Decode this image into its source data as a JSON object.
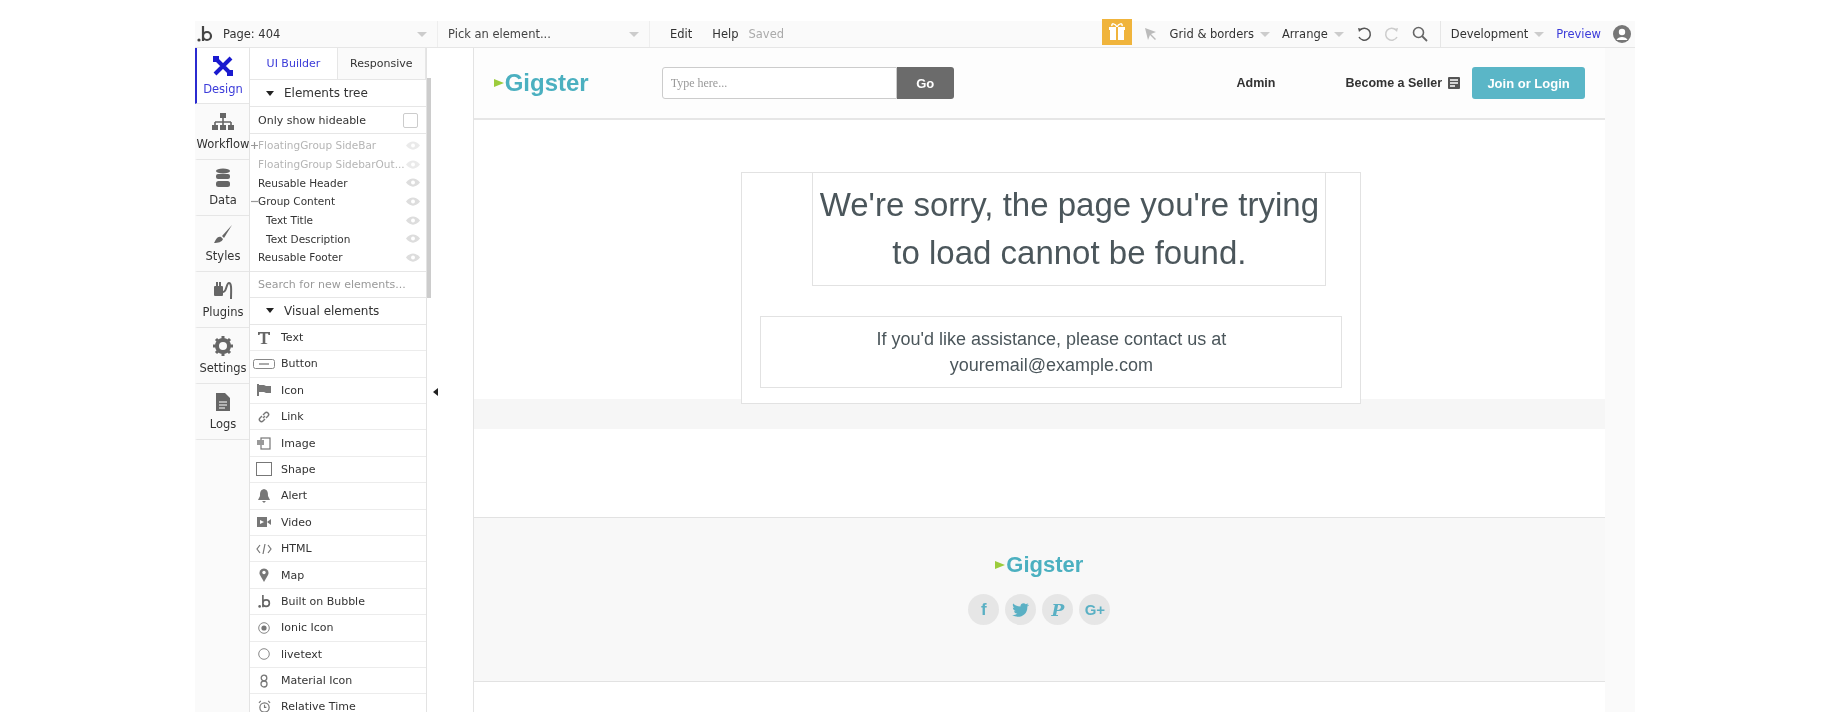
{
  "topbar": {
    "page": "Page: 404",
    "element_picker": {
      "placeholder": "Pick an element..."
    },
    "menu": [
      "Edit",
      "Help"
    ],
    "status": "Saved",
    "tools": [
      "Grid & borders",
      "Arrange"
    ],
    "environment": "Development",
    "preview": "Preview"
  },
  "sidebar": {
    "items": [
      {
        "label": "Design",
        "kind": "design",
        "selected": true
      },
      {
        "label": "Workflow",
        "kind": "workflow",
        "selected": false
      },
      {
        "label": "Data",
        "kind": "data",
        "selected": false
      },
      {
        "label": "Styles",
        "kind": "styles",
        "selected": false
      },
      {
        "label": "Plugins",
        "kind": "plugins",
        "selected": false
      },
      {
        "label": "Settings",
        "kind": "settings",
        "selected": false
      },
      {
        "label": "Logs",
        "kind": "logs",
        "selected": false
      }
    ]
  },
  "panel": {
    "tabs": [
      {
        "label": "UI Builder",
        "selected": true
      },
      {
        "label": "Responsive",
        "selected": false
      }
    ],
    "elements_tree": {
      "title": "Elements tree",
      "expanded": true,
      "only_show_hideable": {
        "label": "Only show hideable",
        "checked": false
      },
      "items": [
        {
          "label": "FloatingGroup SideBar",
          "kind": "group",
          "expanded": false,
          "hidden": true
        },
        {
          "label": "FloatingGroup SidebarOut...",
          "kind": "element",
          "hidden": true
        },
        {
          "label": "Reusable Header",
          "kind": "element",
          "hidden": false
        },
        {
          "label": "Group Content",
          "kind": "group",
          "expanded": true,
          "hidden": false,
          "children": [
            {
              "label": "Text Title",
              "hidden": false
            },
            {
              "label": "Text Description",
              "hidden": false
            }
          ]
        },
        {
          "label": "Reusable Footer",
          "kind": "element",
          "hidden": false
        }
      ]
    },
    "search": {
      "placeholder": "Search for new elements..."
    },
    "visual_elements": {
      "title": "Visual elements",
      "expanded": true,
      "items": [
        {
          "label": "Text",
          "kind": "text"
        },
        {
          "label": "Button",
          "kind": "button"
        },
        {
          "label": "Icon",
          "kind": "icon"
        },
        {
          "label": "Link",
          "kind": "link"
        },
        {
          "label": "Image",
          "kind": "image"
        },
        {
          "label": "Shape",
          "kind": "shape"
        },
        {
          "label": "Alert",
          "kind": "alert"
        },
        {
          "label": "Video",
          "kind": "video"
        },
        {
          "label": "HTML",
          "kind": "html"
        },
        {
          "label": "Map",
          "kind": "map"
        },
        {
          "label": "Built on Bubble",
          "kind": "bubble"
        },
        {
          "label": "Ionic Icon",
          "kind": "ionic"
        },
        {
          "label": "livetext",
          "kind": "livetext"
        },
        {
          "label": "Material Icon",
          "kind": "material"
        },
        {
          "label": "Relative Time",
          "kind": "time"
        }
      ]
    }
  },
  "canvas": {
    "header": {
      "logo": "Gigster",
      "search": {
        "placeholder": "Type here...",
        "button": "Go"
      },
      "nav": [
        "Admin",
        "Become a Seller"
      ],
      "cta": "Join or Login"
    },
    "content": {
      "title": "We're sorry, the page you're trying to load cannot be found.",
      "description": "If you'd like assistance, please contact us at youremail@example.com"
    },
    "footer": {
      "logo": "Gigster",
      "social": [
        {
          "kind": "facebook",
          "glyph": "f"
        },
        {
          "kind": "twitter"
        },
        {
          "kind": "pinterest",
          "glyph": "P"
        },
        {
          "kind": "google",
          "glyph": "G+"
        }
      ]
    }
  }
}
